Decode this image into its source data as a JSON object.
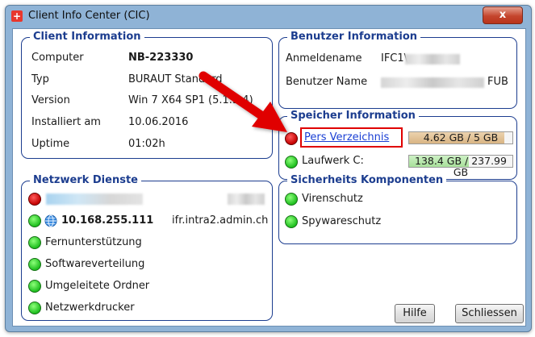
{
  "window": {
    "title": "Client Info Center (CIC)",
    "close_label": "x"
  },
  "client_info": {
    "title": "Client Information",
    "rows": [
      {
        "label": "Computer",
        "value": "NB-223330"
      },
      {
        "label": "Typ",
        "value": "BURAUT Standard"
      },
      {
        "label": "Version",
        "value": "Win 7 X64 SP1 (5.1.3.4)"
      },
      {
        "label": "Installiert am",
        "value": "10.06.2016"
      },
      {
        "label": "Uptime",
        "value": "01:02h"
      }
    ]
  },
  "user_info": {
    "title": "Benutzer Information",
    "login_label": "Anmeldename",
    "login_value": "IFC1\\",
    "user_label": "Benutzer Name",
    "user_value_suffix": "FUB"
  },
  "storage_info": {
    "title": "Speicher Information",
    "pers_label": "Pers Verzeichnis",
    "pers_status": "red",
    "pers_bar_text": "4.62 GB / 5 GB",
    "pers_fill_fraction": 0.924,
    "drive_label": "Laufwerk C:",
    "drive_status": "green",
    "drive_bar_text": "138.4 GB / 237.99 GB",
    "drive_fill_fraction": 0.58,
    "colors": {
      "pers_fill": "#d9b584",
      "drive_fill": "#a8e09a",
      "highlight": "#e00000",
      "arrow": "#e00000"
    }
  },
  "network": {
    "title": "Netzwerk Dienste",
    "ip": "10.168.255.111",
    "domain": "ifr.intra2.admin.ch",
    "services": [
      {
        "label": "Fernunterstützung",
        "status": "green"
      },
      {
        "label": "Softwareverteilung",
        "status": "green"
      },
      {
        "label": "Umgeleitete Ordner",
        "status": "green"
      },
      {
        "label": "Netzwerkdrucker",
        "status": "green"
      }
    ]
  },
  "security": {
    "title": "Sicherheits Komponenten",
    "items": [
      {
        "label": "Virenschutz",
        "status": "green"
      },
      {
        "label": "Spywareschutz",
        "status": "green"
      }
    ]
  },
  "buttons": {
    "help": "Hilfe",
    "close": "Schliessen"
  },
  "icons": {
    "app": "swiss-cross-icon",
    "globe": "globe-icon",
    "close": "close-icon"
  }
}
